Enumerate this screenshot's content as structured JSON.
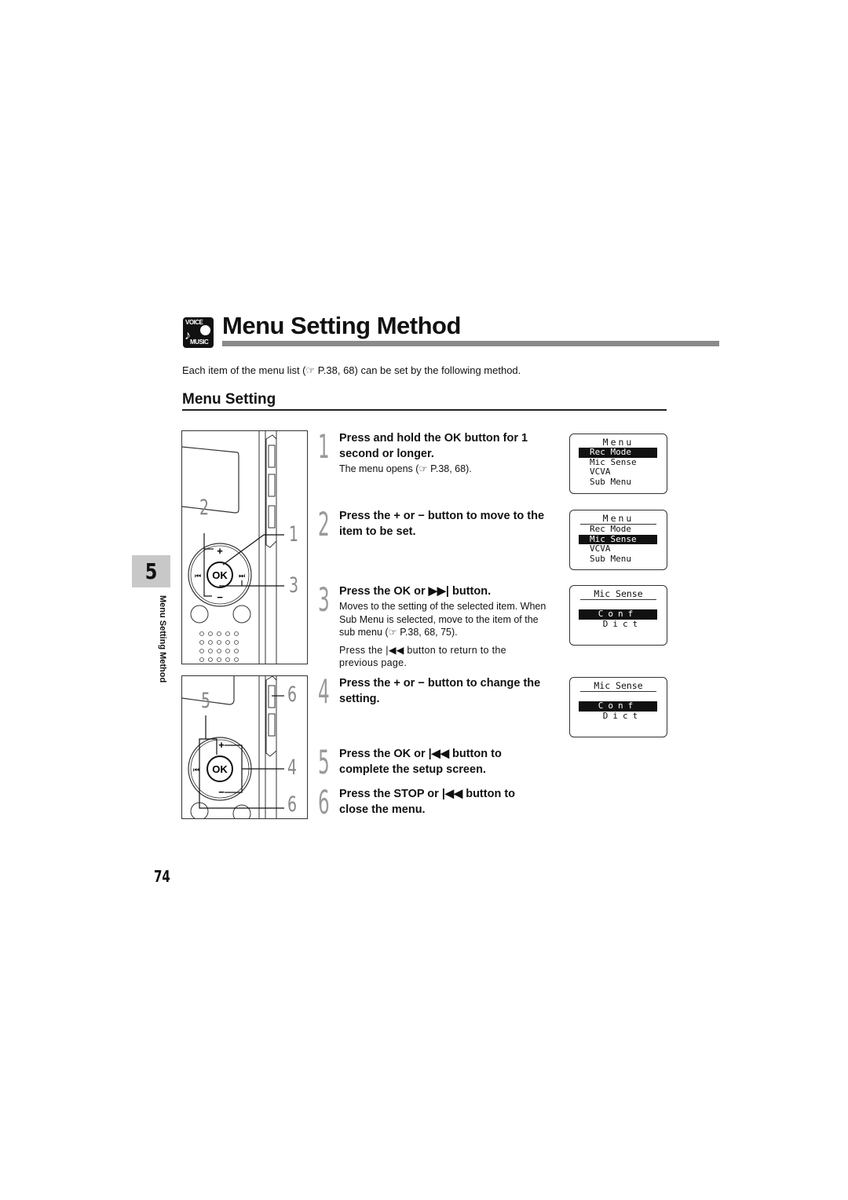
{
  "header": {
    "icon_top": "VOICE",
    "icon_bottom": "MUSIC",
    "title": "Menu Setting Method",
    "intro": "Each item of the menu list (☞ P.38, 68) can be set by the following method."
  },
  "section": {
    "heading": "Menu Setting"
  },
  "side_tab": {
    "chapter": "5",
    "label": "Menu Setting Method"
  },
  "illustrations": {
    "top_callouts": [
      "2",
      "1",
      "3"
    ],
    "bottom_callouts": [
      "5",
      "6",
      "4",
      "6"
    ],
    "button_labels": {
      "ok": "OK",
      "plus": "+",
      "minus": "−",
      "rew": "⏮",
      "ff": "⏭"
    }
  },
  "steps": [
    {
      "num": "1",
      "head": "Press and hold the OK button for 1 second or longer.",
      "note": "The menu opens (☞ P.38, 68).",
      "note2": ""
    },
    {
      "num": "2",
      "head": "Press the + or − button to move to the item to be set.",
      "note": "",
      "note2": ""
    },
    {
      "num": "3",
      "head": "Press the OK or ▶▶| button.",
      "note": "Moves to the setting of the selected item. When Sub Menu is selected, move to the item of the sub menu (☞ P.38, 68, 75).",
      "note2": "Press the |◀◀ button to return to the previous page."
    },
    {
      "num": "4",
      "head": "Press the + or − button to change the setting.",
      "note": "",
      "note2": ""
    },
    {
      "num": "5",
      "head": "Press the OK or |◀◀ button to complete the setup screen.",
      "note": "",
      "note2": ""
    },
    {
      "num": "6",
      "head": "Press the STOP or |◀◀ button to close the menu.",
      "note": "",
      "note2": ""
    }
  ],
  "screens": [
    {
      "title": "Menu",
      "items": [
        "Rec Mode",
        "Mic Sense",
        "VCVA",
        "Sub Menu"
      ],
      "selected": 0,
      "blinking": true
    },
    {
      "title": "Menu",
      "items": [
        "Rec Mode",
        "Mic Sense",
        "VCVA",
        "Sub Menu"
      ],
      "selected": 1,
      "blinking": true
    },
    {
      "title": "Mic Sense",
      "items": [
        "Conf",
        "Dict"
      ],
      "selected": 0,
      "blinking": true
    },
    {
      "title": "Mic Sense",
      "items": [
        "Conf",
        "Dict"
      ],
      "selected": 0,
      "blinking": true
    }
  ],
  "footer": {
    "page_number": "74"
  }
}
